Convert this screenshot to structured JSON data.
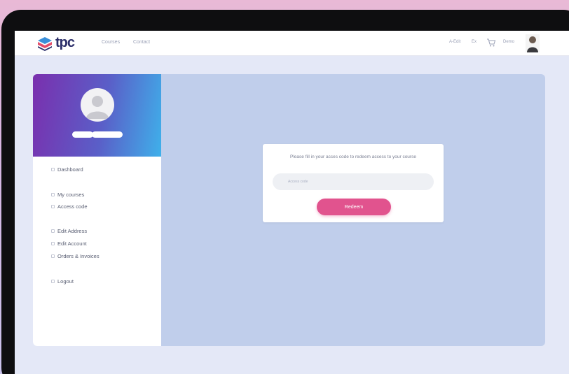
{
  "brand": {
    "name": "tpc"
  },
  "nav": {
    "links": [
      "Courses",
      "Contact"
    ],
    "right": [
      "A-Edit",
      "Ex",
      "Demo"
    ]
  },
  "sidebar": {
    "items": [
      {
        "label": "Dashboard"
      },
      {
        "label": "My courses"
      },
      {
        "label": "Access code"
      },
      {
        "label": "Edit Address"
      },
      {
        "label": "Edit Account"
      },
      {
        "label": "Orders & Invoices"
      },
      {
        "label": "Logout"
      }
    ]
  },
  "redeem": {
    "message": "Please fill in your acces code to redeem access to your course",
    "placeholder": "Access code",
    "button_label": "Redeem"
  },
  "colors": {
    "accent": "#e1538e",
    "panel_bg": "#c0ceeb",
    "brand_dark": "#2c2f6a"
  }
}
